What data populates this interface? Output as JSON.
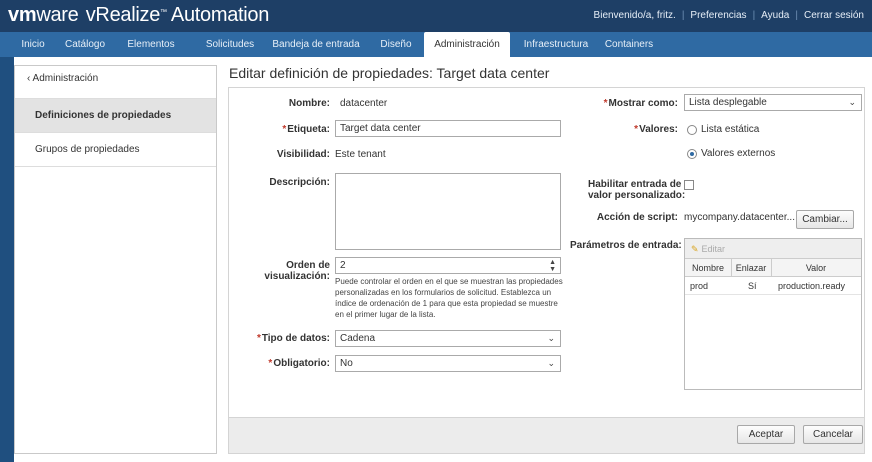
{
  "header": {
    "brand_vm": "vm",
    "brand_ware": "ware",
    "brand_product": "vRealize",
    "brand_module": "Automation",
    "tm": "™",
    "welcome": "Bienvenido/a, fritz.",
    "preferences": "Preferencias",
    "help": "Ayuda",
    "logout": "Cerrar sesión"
  },
  "nav": {
    "tabs": [
      "Inicio",
      "Catálogo",
      "Elementos",
      "Solicitudes",
      "Bandeja de entrada",
      "Diseño",
      "Administración",
      "Infraestructura",
      "Containers"
    ],
    "active": "Administración"
  },
  "sidebar": {
    "back_label": "‹ Administración",
    "items": [
      "Definiciones de propiedades",
      "Grupos de propiedades"
    ]
  },
  "page": {
    "title": "Editar definición de propiedades: Target data center"
  },
  "form": {
    "name_label": "Nombre:",
    "name_value": "datacenter",
    "label_label": "Etiqueta:",
    "label_value": "Target data center",
    "visibility_label": "Visibilidad:",
    "visibility_value": "Este tenant",
    "description_label": "Descripción:",
    "description_value": "",
    "order_label_1": "Orden de",
    "order_label_2": "visualización:",
    "order_value": "2",
    "order_help": "Puede controlar el orden en el que se muestran las propiedades personalizadas en los formularios de solicitud. Establezca un índice de ordenación de 1 para que esta propiedad se muestre en el primer lugar de la lista.",
    "datatype_label": "Tipo de datos:",
    "datatype_value": "Cadena",
    "required_label": "Obligatorio:",
    "required_value": "No",
    "display_as_label": "Mostrar como:",
    "display_as_value": "Lista desplegable",
    "values_label": "Valores:",
    "values_static": "Lista estática",
    "values_external": "Valores externos",
    "custom_label_1": "Habilitar entrada de",
    "custom_label_2": "valor personalizado:",
    "script_label": "Acción de script:",
    "script_value": "mycompany.datacenter...",
    "change_button": "Cambiar...",
    "params_label": "Parámetros de entrada:",
    "required_marker": "*"
  },
  "params_table": {
    "edit_label": "Editar",
    "columns": [
      "Nombre",
      "Enlazar",
      "Valor"
    ],
    "rows": [
      {
        "name": "prod",
        "bind": "Sí",
        "value": "production.ready"
      }
    ]
  },
  "footer": {
    "accept": "Aceptar",
    "cancel": "Cancelar"
  }
}
